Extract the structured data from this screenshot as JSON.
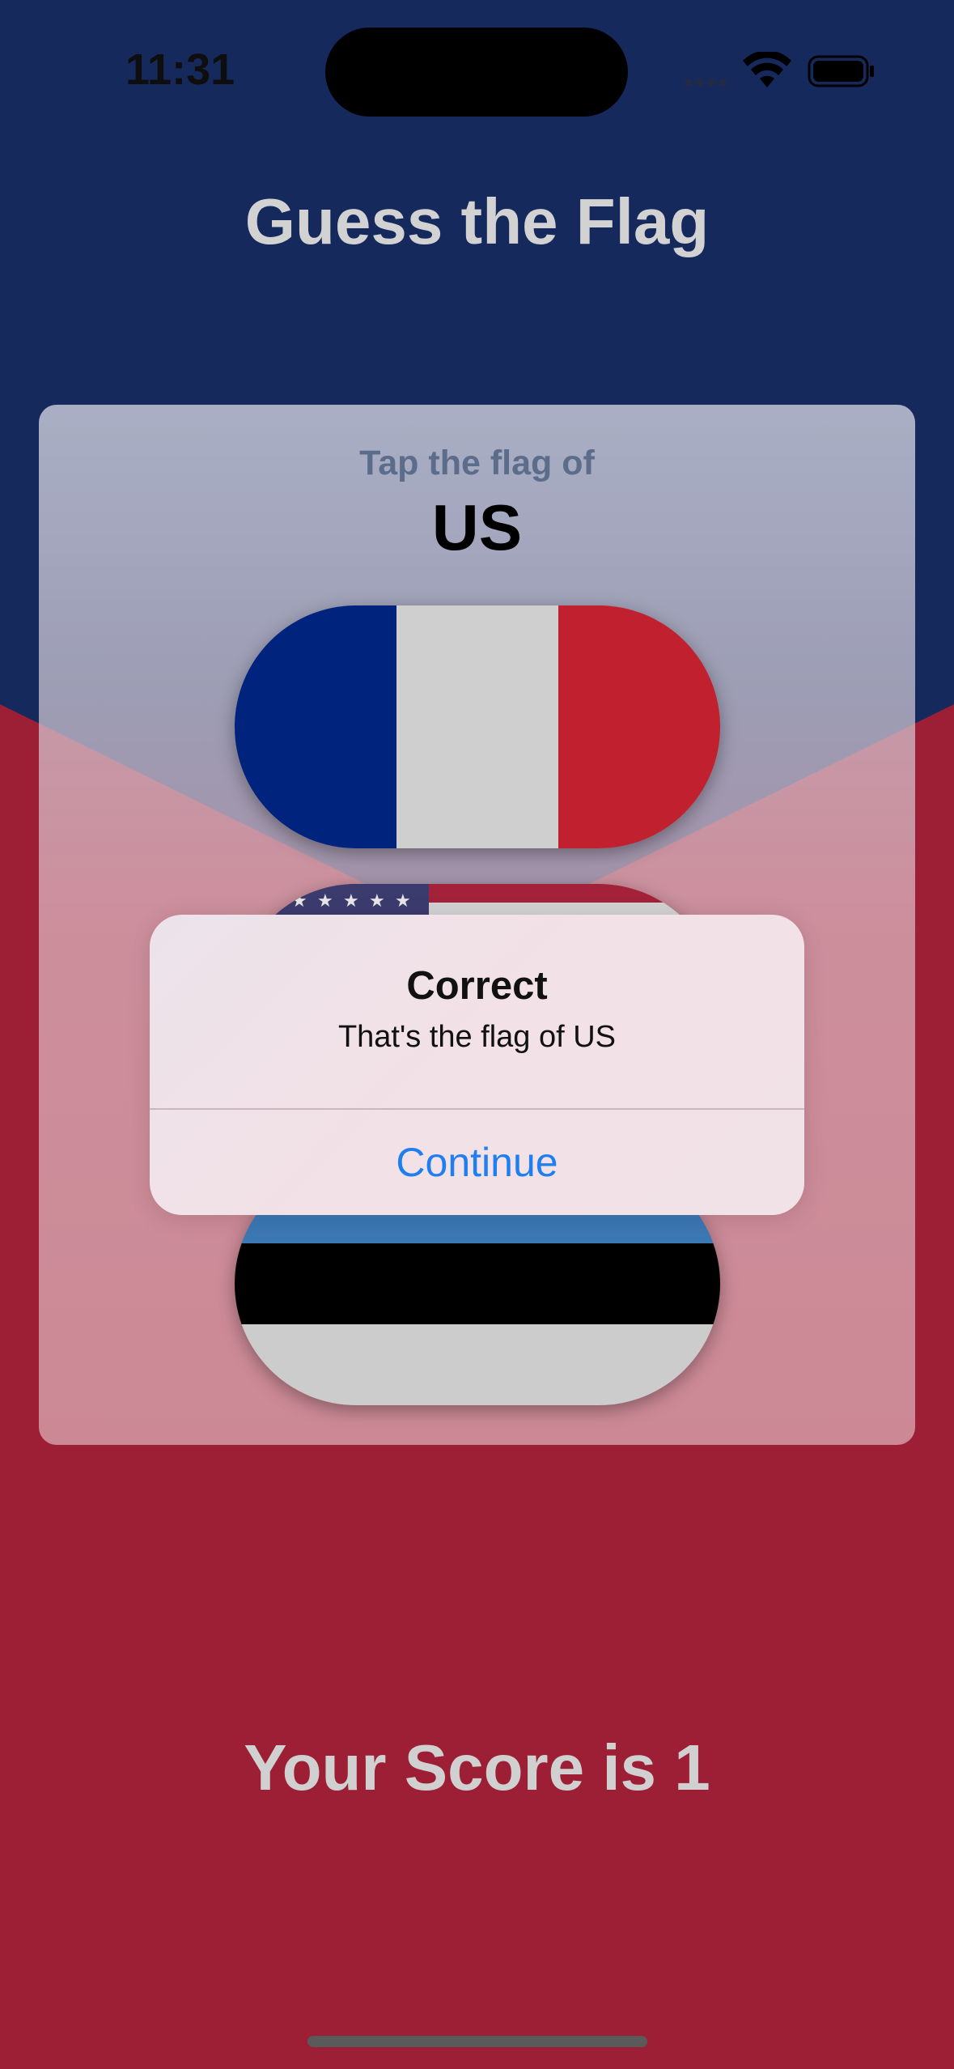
{
  "status_bar": {
    "time": "11:31",
    "icons": [
      "cellular-icon",
      "wifi-icon",
      "battery-icon"
    ]
  },
  "app": {
    "title": "Guess the Flag",
    "score_text": "Your Score is 1"
  },
  "question": {
    "prompt": "Tap the flag of",
    "country": "US"
  },
  "flags": [
    {
      "name": "France",
      "colors": [
        "#00247d",
        "#d2d2d2",
        "#c1212f"
      ]
    },
    {
      "name": "US",
      "colors": [
        "#3c3b6e",
        "#b22234",
        "#d2d2d2"
      ]
    },
    {
      "name": "Estonia",
      "colors": [
        "#3c78b4",
        "#000000",
        "#cccccc"
      ]
    }
  ],
  "alert": {
    "title": "Correct",
    "message": "That's the flag of US",
    "button_label": "Continue"
  },
  "colors": {
    "background_blue": "#16295c",
    "background_red": "#9c1f35",
    "accent": "#1f7ff0"
  }
}
